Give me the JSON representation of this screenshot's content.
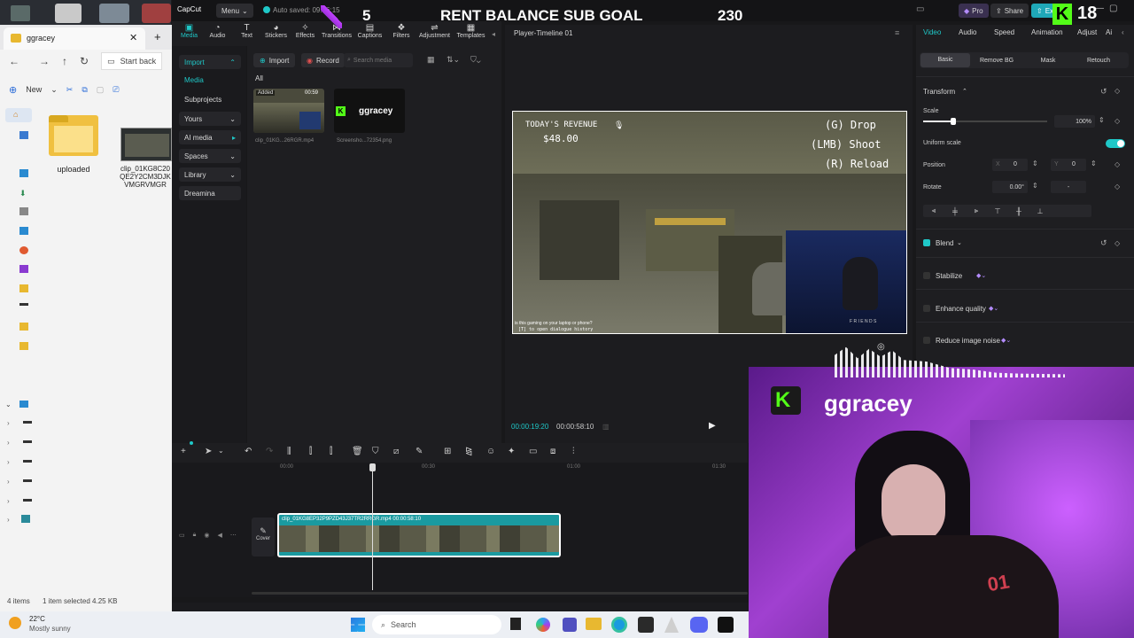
{
  "explorer": {
    "tab_title": "ggracey",
    "address": "Start back",
    "new_label": "New",
    "folder_name": "uploaded",
    "file_name": "clip_01KG8C20QE2Y2CM3DJKVMGRVMGR",
    "status_items": "4 items",
    "status_selected": "1 item selected  4.25 KB"
  },
  "capcut": {
    "brand": "CapCut",
    "menu_label": "Menu",
    "autosave": "Auto saved: 09:06:15",
    "toolbar": [
      "Media",
      "Audio",
      "Text",
      "Stickers",
      "Effects",
      "Transitions",
      "Captions",
      "Filters",
      "Adjustment",
      "Templates"
    ],
    "sidebar": [
      "Import",
      "Media",
      "Subprojects",
      "Yours",
      "AI media",
      "Spaces",
      "Library",
      "Dreamina"
    ],
    "import_btn": "Import",
    "record_btn": "Record",
    "search_placeholder": "Search media",
    "filter_all": "All",
    "media_items": [
      {
        "name": "clip_01KG...26RGR.mp4",
        "badge": "Added",
        "duration": "00:59"
      },
      {
        "name": "Screensho...72354.png",
        "logo": "ggracey"
      }
    ],
    "player_title": "Player-Timeline 01",
    "time_current": "00:00:19:20",
    "time_total": "00:00:58:10",
    "ruler": [
      "00:00",
      "00:30",
      "01:00",
      "01:30"
    ],
    "clip_label": "clip_01KG8EP32P9PZD43J37TR2RRGR.mp4   00:00:58:10",
    "cover_label": "Cover",
    "pro_label": "Pro",
    "share_label": "Share",
    "export_label": "Ex",
    "right_tabs": [
      "Video",
      "Audio",
      "Speed",
      "Animation",
      "Adjust",
      "Ai"
    ],
    "sub_tabs": [
      "Basic",
      "Remove BG",
      "Mask",
      "Retouch"
    ],
    "transform": "Transform",
    "scale_label": "Scale",
    "scale_value": "100%",
    "uniform_scale": "Uniform scale",
    "position_label": "Position",
    "pos_x_label": "X",
    "pos_x": "0",
    "pos_y_label": "Y",
    "pos_y": "0",
    "rotate_label": "Rotate",
    "rotate_value": "0.00°",
    "rotate_dash": "-",
    "blend": "Blend",
    "stabilize": "Stabilize",
    "enhance": "Enhance quality",
    "reduce_noise": "Reduce image noise"
  },
  "game": {
    "revenue_label": "TODAY'S REVENUE",
    "revenue_value": "$48.00",
    "controls": [
      "(G) Drop",
      "(LMB) Shoot",
      "(R) Reload"
    ],
    "subtitle1": "is this gaming on your laptop or phone?",
    "subtitle2": "[T] to open dialogue history",
    "friends": "F R I E N D S"
  },
  "overlay": {
    "goal_current": "5",
    "goal_title": "RENT BALANCE SUB GOAL",
    "goal_target": "230",
    "kick_count": "18",
    "streamer": "ggracey"
  },
  "taskbar": {
    "temp": "22°C",
    "weather": "Mostly sunny",
    "search": "Search"
  },
  "colors": {
    "accent": "#1fc8c8",
    "kick": "#53fc18",
    "purple": "#8a4bd8"
  }
}
